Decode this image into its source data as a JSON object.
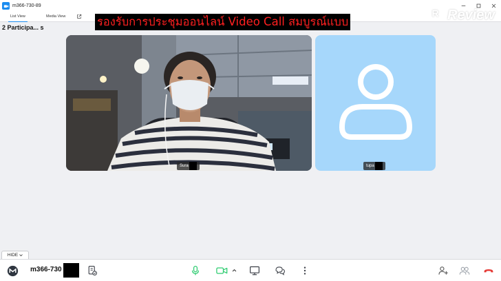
{
  "window": {
    "title": "m366-730-89",
    "app_icon": "camera-app-icon"
  },
  "tabs": {
    "list_view": "List View",
    "media_view": "Media View",
    "popout_icon": "external-link-icon"
  },
  "banner": {
    "text": "รองรับการประชุมออนไลน์ Video Call สมบูรณ์แบบ",
    "color": "#ff2020"
  },
  "watermark": {
    "badge": "R",
    "text": "Review"
  },
  "participants_label": "2 Participa... s",
  "tiles": [
    {
      "name": "Sura",
      "type": "camera-video"
    },
    {
      "name": "tupa",
      "type": "avatar",
      "background": "#a6d7fb"
    }
  ],
  "hide_tab": {
    "label": "HIDE"
  },
  "toolbar": {
    "meeting_id": "m366-730",
    "mic_color": "#2ecc71",
    "camera_color": "#2ecc71",
    "end_call_color": "#e53935",
    "icons": [
      "meeting-info-icon",
      "microphone-icon",
      "video-camera-icon",
      "chevron-up-icon",
      "screen-share-icon",
      "chat-icon",
      "more-icon",
      "add-participant-icon",
      "participants-icon",
      "end-call-icon"
    ]
  },
  "colors": {
    "accent": "#1a8cf0",
    "background": "#eff0f3"
  }
}
